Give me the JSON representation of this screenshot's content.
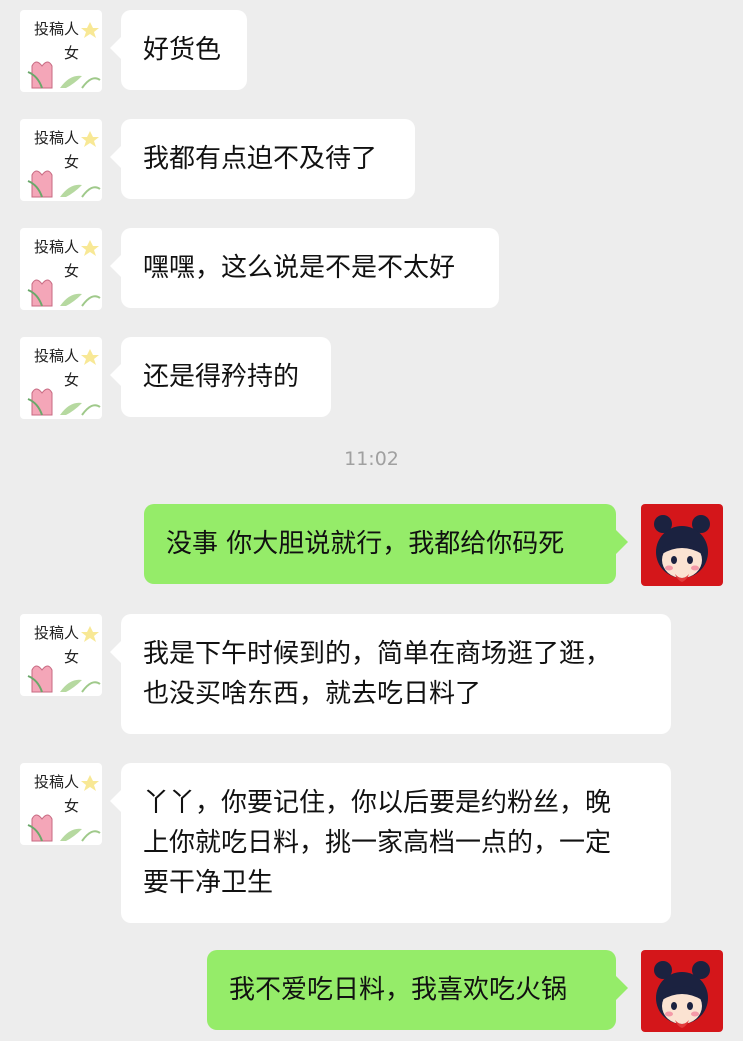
{
  "timestamp": "11:02",
  "avatars": {
    "incoming": {
      "line1": "投稿人",
      "line2": "女"
    }
  },
  "messages": [
    {
      "side": "in",
      "text": "好货色"
    },
    {
      "side": "in",
      "text": "我都有点迫不及待了"
    },
    {
      "side": "in",
      "text": "嘿嘿，这么说是不是不太好"
    },
    {
      "side": "in",
      "text": "还是得矜持的"
    },
    {
      "side": "out",
      "text": "没事 你大胆说就行，我都给你码死"
    },
    {
      "side": "in",
      "text": "我是下午时候到的，简单在商场逛了逛，\n也没买啥东西，就去吃日料了"
    },
    {
      "side": "in",
      "text": "丫丫，你要记住，你以后要是约粉丝，晚\n上你就吃日料，挑一家高档一点的，一定\n要干净卫生"
    },
    {
      "side": "out",
      "text": "我不爱吃日料，我喜欢吃火锅"
    }
  ],
  "colors": {
    "background": "#ededed",
    "incoming_bubble": "#ffffff",
    "outgoing_bubble": "#95ec69",
    "outgoing_avatar_bg": "#d4161a"
  },
  "icons": {
    "incoming_avatar": "tulip-sketch-avatar",
    "outgoing_avatar": "cartoon-girl-avatar"
  }
}
